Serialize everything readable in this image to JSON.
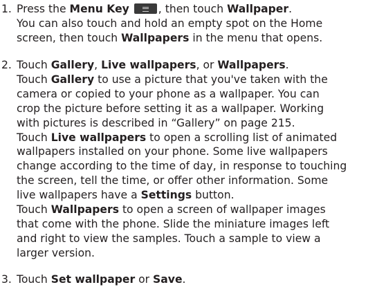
{
  "steps": [
    {
      "num": "1.",
      "lines": [
        {
          "parts": [
            "Press the ",
            "Menu Key",
            "",
            ", then touch ",
            "Wallpaper",
            "."
          ]
        },
        {
          "text": "You can also touch and hold an empty spot on the Home"
        },
        {
          "parts": [
            "screen, then touch ",
            "Wallpapers",
            " in the menu that opens."
          ]
        }
      ]
    },
    {
      "num": "2.",
      "lines": [
        {
          "parts": [
            "Touch ",
            "Gallery",
            ", ",
            "Live wallpapers",
            ", or ",
            "Wallpapers",
            "."
          ]
        },
        {
          "parts": [
            "Touch ",
            "Gallery",
            " to use a picture that you've taken with the"
          ]
        },
        {
          "text": "camera or copied to your phone as a wallpaper. You can"
        },
        {
          "text": "crop the picture before setting it as a wallpaper. Working"
        },
        {
          "text": "with pictures is described in “Gallery” on page 215."
        },
        {
          "parts": [
            "Touch ",
            "Live wallpapers",
            " to open a scrolling list of animated"
          ]
        },
        {
          "text": "wallpapers installed on your phone. Some live wallpapers"
        },
        {
          "text": "change according to the time of day, in response to touching"
        },
        {
          "text": "the screen, tell the time, or offer other information. Some"
        },
        {
          "parts": [
            "live wallpapers have a ",
            "Settings",
            " button."
          ]
        },
        {
          "parts": [
            "Touch ",
            "Wallpapers",
            " to open a screen of wallpaper images"
          ]
        },
        {
          "text": "that come with the phone. Slide the miniature images left"
        },
        {
          "text": "and right to view the samples. Touch a sample to view a"
        },
        {
          "text": "larger version."
        }
      ]
    },
    {
      "num": "3.",
      "lines": [
        {
          "parts": [
            "Touch ",
            "Set wallpaper",
            " or ",
            "Save",
            "."
          ]
        }
      ]
    }
  ],
  "icons": {
    "menu_key": "menu-key-icon"
  }
}
